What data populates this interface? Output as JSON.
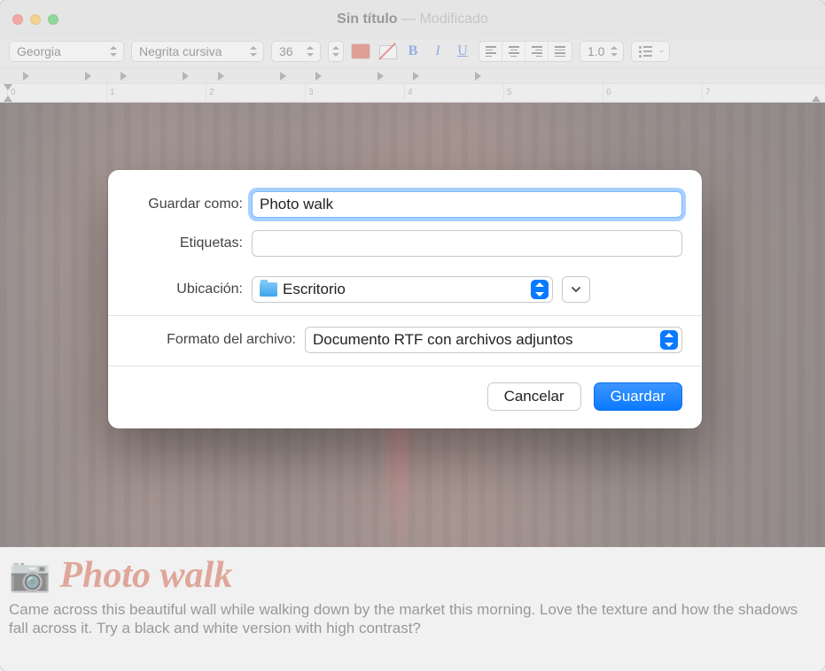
{
  "window": {
    "title_untitled": "Sin título",
    "title_sep": " — ",
    "title_modified": "Modificado"
  },
  "toolbar": {
    "font_family": "Georgia",
    "font_style": "Negrita cursiva",
    "font_size": "36",
    "line_spacing": "1.0"
  },
  "ruler": {
    "ticks": [
      "0",
      "1",
      "2",
      "3",
      "4",
      "5",
      "6",
      "7"
    ]
  },
  "document": {
    "heading_emoji": "📷",
    "heading": "Photo walk",
    "body": "Came across this beautiful wall while walking down by the market this morning. Love the texture and how the shadows fall across it. Try a black and white version with high contrast?"
  },
  "dialog": {
    "save_as_label": "Guardar como:",
    "save_as_value": "Photo walk",
    "tags_label": "Etiquetas:",
    "tags_value": "",
    "location_label": "Ubicación:",
    "location_value": "Escritorio",
    "format_label": "Formato del archivo:",
    "format_value": "Documento RTF con archivos adjuntos",
    "cancel": "Cancelar",
    "save": "Guardar"
  }
}
